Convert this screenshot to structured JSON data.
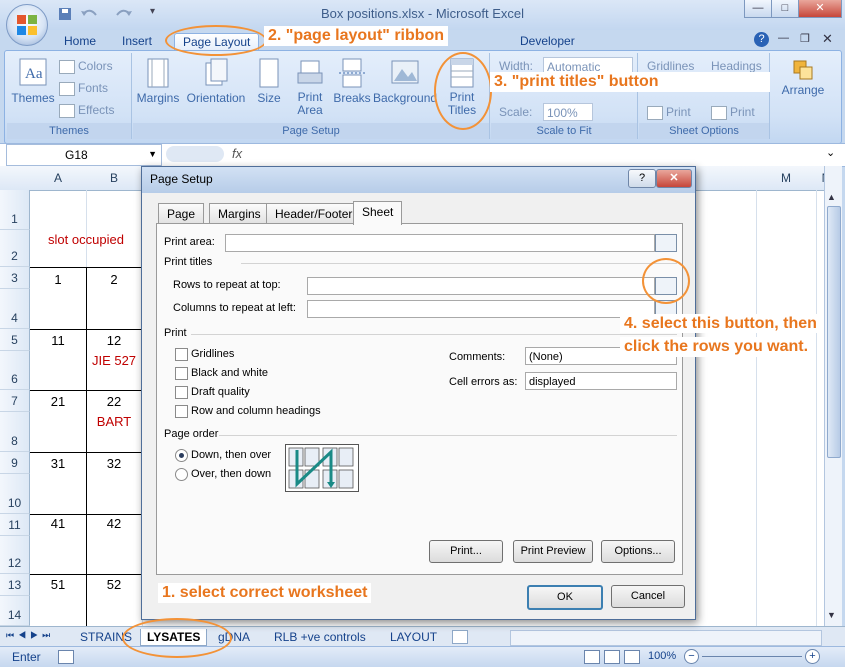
{
  "window": {
    "title": "Box positions.xlsx - Microsoft Excel",
    "controls": {
      "minimize": "—",
      "maximize": "□",
      "close": "✕"
    }
  },
  "quick_access": [
    "save-icon",
    "undo-icon",
    "redo-icon"
  ],
  "ribbon_tabs": [
    "Home",
    "Insert",
    "Page Layout",
    "Developer"
  ],
  "ribbon": {
    "themes": {
      "label": "Themes",
      "themes_btn": "Themes",
      "colors": "Colors",
      "fonts": "Fonts",
      "effects": "Effects"
    },
    "page_setup": {
      "label": "Page Setup",
      "buttons": [
        "Margins",
        "Orientation",
        "Size",
        "Print Area",
        "Breaks",
        "Background",
        "Print Titles"
      ]
    },
    "scale_to_fit": {
      "label": "Scale to Fit",
      "width_label": "Width:",
      "width_value": "Automatic",
      "scale_label": "Scale:",
      "scale_value": "100%"
    },
    "sheet_options": {
      "label": "Sheet Options",
      "gridlines": "Gridlines",
      "headings": "Headings",
      "print1": "Print",
      "print2": "Print"
    },
    "arrange": {
      "label": "Arrange"
    }
  },
  "namebox": {
    "value": "G18"
  },
  "formula_bar": {
    "fx": "fx",
    "value": ""
  },
  "grid": {
    "columns": [
      "A",
      "B",
      "M",
      "N"
    ],
    "rows": [
      "1",
      "2",
      "3",
      "4",
      "5",
      "6",
      "7",
      "8",
      "9",
      "10",
      "11",
      "12",
      "13",
      "14"
    ],
    "cells": {
      "a2": "slot occupied",
      "a3": "1",
      "b3": "2",
      "a5": "11",
      "b5": "12",
      "b6": "JIE 527",
      "a7": "21",
      "b7": "22",
      "b8": "BART",
      "a9": "31",
      "b9": "32",
      "a11": "41",
      "b11": "42",
      "a13": "51",
      "b13": "52"
    }
  },
  "sheet_tabs": [
    "STRAINS",
    "LYSATES",
    "gDNA",
    "RLB +ve controls",
    "LAYOUT"
  ],
  "status": {
    "mode": "Enter",
    "zoom": "100%"
  },
  "dialog": {
    "title": "Page Setup",
    "tabs": [
      "Page",
      "Margins",
      "Header/Footer",
      "Sheet"
    ],
    "active_tab": "Sheet",
    "print_area_label": "Print area:",
    "print_titles_label": "Print titles",
    "rows_repeat_label": "Rows to repeat at top:",
    "cols_repeat_label": "Columns to repeat at left:",
    "print_label": "Print",
    "checkboxes": [
      "Gridlines",
      "Black and white",
      "Draft quality",
      "Row and column headings"
    ],
    "comments_label": "Comments:",
    "comments_value": "(None)",
    "cell_errors_label": "Cell errors as:",
    "cell_errors_value": "displayed",
    "page_order_label": "Page order",
    "radios": [
      "Down, then over",
      "Over, then down"
    ],
    "buttons": {
      "print": "Print...",
      "preview": "Print Preview",
      "options": "Options...",
      "ok": "OK",
      "cancel": "Cancel"
    }
  },
  "annotations": {
    "a1": "1. select correct worksheet",
    "a2": "2. \"page layout\" ribbon",
    "a3": "3. \"print titles\" button",
    "a4_line1": "4. select this button, then",
    "a4_line2": "click the rows you want."
  },
  "colors": {
    "accent": "#e8761e",
    "cell_red": "#c00000",
    "ribbon": "#d2e2f6"
  }
}
